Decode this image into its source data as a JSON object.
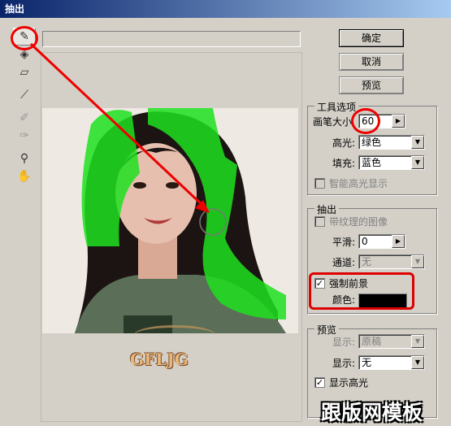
{
  "window": {
    "title": "抽出"
  },
  "tools": [
    "edge-highlighter-icon",
    "fill-icon",
    "eraser-icon",
    "eyedropper-icon",
    "cleanup-icon",
    "edge-touchup-icon",
    "zoom-icon",
    "hand-icon"
  ],
  "buttons": {
    "ok": "确定",
    "cancel": "取消",
    "preview": "预览"
  },
  "tool_options": {
    "title": "工具选项",
    "brush_size_label": "画笔大小",
    "brush_size_value": "60",
    "highlight_label": "高光:",
    "highlight_value": "绿色",
    "fill_label": "填充:",
    "fill_value": "蓝色",
    "smart_highlight_label": "智能高光显示"
  },
  "extraction": {
    "title": "抽出",
    "textured_label": "带纹理的图像",
    "smooth_label": "平滑:",
    "smooth_value": "0",
    "channel_label": "通道:",
    "channel_value": "无",
    "force_fg_label": "强制前景",
    "force_fg_checked": true,
    "color_label": "颜色:",
    "color_value": "#000000"
  },
  "preview_group": {
    "title": "预览",
    "show_label_1": "显示:",
    "show_value_1": "原稿",
    "show_label_2": "显示:",
    "show_value_2": "无",
    "show_highlight_label": "显示高光"
  },
  "image_watermark": "GFLJG",
  "site_watermark": "跟版网模板"
}
